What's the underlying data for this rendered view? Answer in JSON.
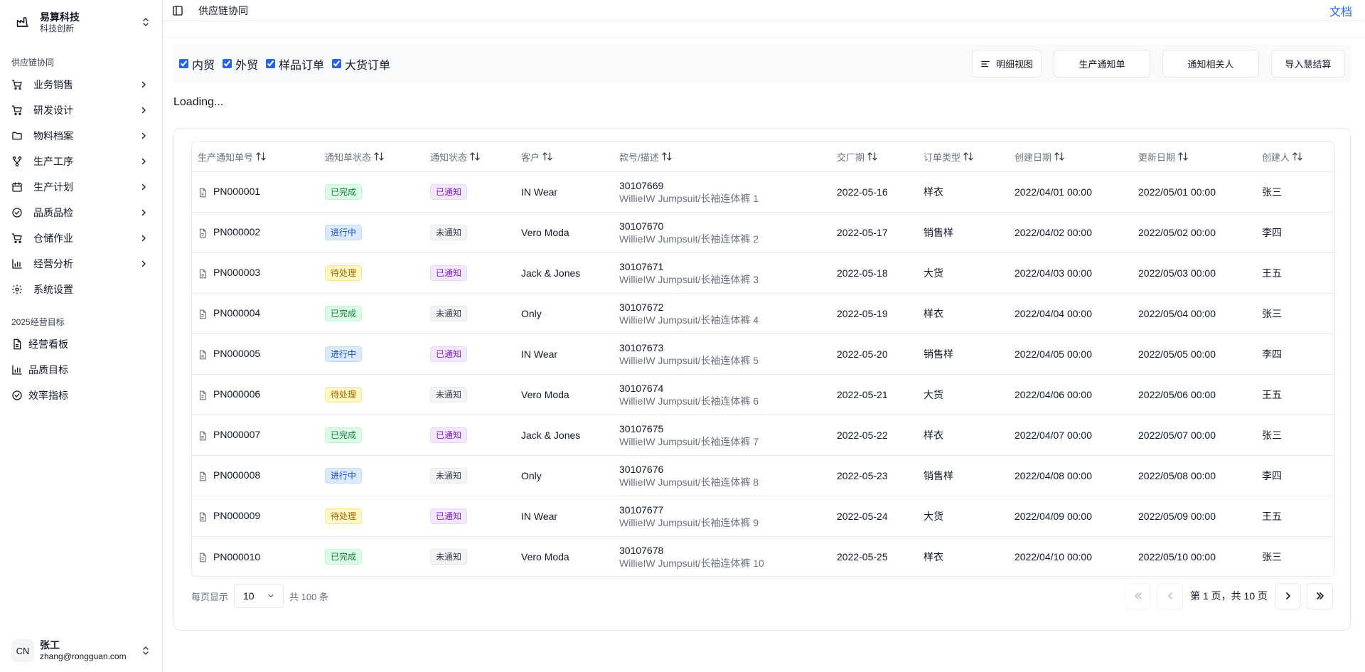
{
  "brand": {
    "name": "易算科技",
    "subtitle": "科技创新"
  },
  "sidebar": {
    "group1_label": "供应链协同",
    "items": [
      {
        "label": "业务销售",
        "icon": "cart-icon",
        "has_children": true
      },
      {
        "label": "研发设计",
        "icon": "cart-icon",
        "has_children": true
      },
      {
        "label": "物料档案",
        "icon": "folder-icon",
        "has_children": true
      },
      {
        "label": "生产工序",
        "icon": "workflow-icon",
        "has_children": true
      },
      {
        "label": "生产计划",
        "icon": "calendar-icon",
        "has_children": true
      },
      {
        "label": "品质品检",
        "icon": "check-circle-icon",
        "has_children": true
      },
      {
        "label": "仓储作业",
        "icon": "cart-icon",
        "has_children": true
      },
      {
        "label": "经营分析",
        "icon": "bar-chart-icon",
        "has_children": true
      },
      {
        "label": "系统设置",
        "icon": "gear-icon",
        "has_children": false
      }
    ],
    "group2_label": "2025经营目标",
    "items2": [
      {
        "label": "经营看板",
        "icon": "document-icon"
      },
      {
        "label": "品质目标",
        "icon": "bar-chart-icon"
      },
      {
        "label": "效率指标",
        "icon": "check-circle-icon"
      }
    ]
  },
  "user": {
    "initials": "CN",
    "name": "张工",
    "email": "zhang@rongguan.com"
  },
  "header": {
    "breadcrumb": "供应链协同",
    "docs_link": "文档"
  },
  "filters": [
    {
      "label": "内贸",
      "checked": true
    },
    {
      "label": "外贸",
      "checked": true
    },
    {
      "label": "样品订单",
      "checked": true
    },
    {
      "label": "大货订单",
      "checked": true
    }
  ],
  "actions": {
    "detail_view": "明细视图",
    "production_notice": "生产通知单",
    "notify_related": "通知相关人",
    "import_settlement": "导入慧结算"
  },
  "loading_text": "Loading...",
  "table": {
    "columns": [
      "生产通知单号",
      "通知单状态",
      "通知状态",
      "客户",
      "款号/描述",
      "交厂期",
      "订单类型",
      "创建日期",
      "更新日期",
      "创建人"
    ],
    "rows": [
      {
        "no": "PN000001",
        "status": "已完成",
        "notify": "已通知",
        "customer": "IN Wear",
        "code": "30107669",
        "desc": "WillieIW Jumpsuit/长袖连体裤 1",
        "due": "2022-05-16",
        "type": "样衣",
        "created": "2022/04/01 00:00",
        "updated": "2022/05/01 00:00",
        "creator": "张三"
      },
      {
        "no": "PN000002",
        "status": "进行中",
        "notify": "未通知",
        "customer": "Vero Moda",
        "code": "30107670",
        "desc": "WillieIW Jumpsuit/长袖连体裤 2",
        "due": "2022-05-17",
        "type": "销售样",
        "created": "2022/04/02 00:00",
        "updated": "2022/05/02 00:00",
        "creator": "李四"
      },
      {
        "no": "PN000003",
        "status": "待处理",
        "notify": "已通知",
        "customer": "Jack & Jones",
        "code": "30107671",
        "desc": "WillieIW Jumpsuit/长袖连体裤 3",
        "due": "2022-05-18",
        "type": "大货",
        "created": "2022/04/03 00:00",
        "updated": "2022/05/03 00:00",
        "creator": "王五"
      },
      {
        "no": "PN000004",
        "status": "已完成",
        "notify": "未通知",
        "customer": "Only",
        "code": "30107672",
        "desc": "WillieIW Jumpsuit/长袖连体裤 4",
        "due": "2022-05-19",
        "type": "样衣",
        "created": "2022/04/04 00:00",
        "updated": "2022/05/04 00:00",
        "creator": "张三"
      },
      {
        "no": "PN000005",
        "status": "进行中",
        "notify": "已通知",
        "customer": "IN Wear",
        "code": "30107673",
        "desc": "WillieIW Jumpsuit/长袖连体裤 5",
        "due": "2022-05-20",
        "type": "销售样",
        "created": "2022/04/05 00:00",
        "updated": "2022/05/05 00:00",
        "creator": "李四"
      },
      {
        "no": "PN000006",
        "status": "待处理",
        "notify": "未通知",
        "customer": "Vero Moda",
        "code": "30107674",
        "desc": "WillieIW Jumpsuit/长袖连体裤 6",
        "due": "2022-05-21",
        "type": "大货",
        "created": "2022/04/06 00:00",
        "updated": "2022/05/06 00:00",
        "creator": "王五"
      },
      {
        "no": "PN000007",
        "status": "已完成",
        "notify": "已通知",
        "customer": "Jack & Jones",
        "code": "30107675",
        "desc": "WillieIW Jumpsuit/长袖连体裤 7",
        "due": "2022-05-22",
        "type": "样衣",
        "created": "2022/04/07 00:00",
        "updated": "2022/05/07 00:00",
        "creator": "张三"
      },
      {
        "no": "PN000008",
        "status": "进行中",
        "notify": "未通知",
        "customer": "Only",
        "code": "30107676",
        "desc": "WillieIW Jumpsuit/长袖连体裤 8",
        "due": "2022-05-23",
        "type": "销售样",
        "created": "2022/04/08 00:00",
        "updated": "2022/05/08 00:00",
        "creator": "李四"
      },
      {
        "no": "PN000009",
        "status": "待处理",
        "notify": "已通知",
        "customer": "IN Wear",
        "code": "30107677",
        "desc": "WillieIW Jumpsuit/长袖连体裤 9",
        "due": "2022-05-24",
        "type": "大货",
        "created": "2022/04/09 00:00",
        "updated": "2022/05/09 00:00",
        "creator": "王五"
      },
      {
        "no": "PN000010",
        "status": "已完成",
        "notify": "未通知",
        "customer": "Vero Moda",
        "code": "30107678",
        "desc": "WillieIW Jumpsuit/长袖连体裤 10",
        "due": "2022-05-25",
        "type": "样衣",
        "created": "2022/04/10 00:00",
        "updated": "2022/05/10 00:00",
        "creator": "张三"
      }
    ]
  },
  "status_colors": {
    "已完成": {
      "bg": "#dcfce7",
      "fg": "#15803d",
      "border": "#bbf7d0"
    },
    "进行中": {
      "bg": "#dbeafe",
      "fg": "#1d4ed8",
      "border": "#bfdbfe"
    },
    "待处理": {
      "bg": "#fef9c3",
      "fg": "#a16207",
      "border": "#fde68a"
    },
    "已通知": {
      "bg": "#f3e8ff",
      "fg": "#7e22ce",
      "border": "#e9d5ff"
    },
    "未通知": {
      "bg": "#f3f4f6",
      "fg": "#374151",
      "border": "#e5e7eb"
    }
  },
  "pagination": {
    "per_page_label": "每页显示",
    "page_size": "10",
    "total_text": "共 100 条",
    "page_info": "第 1 页，共 10 页"
  }
}
